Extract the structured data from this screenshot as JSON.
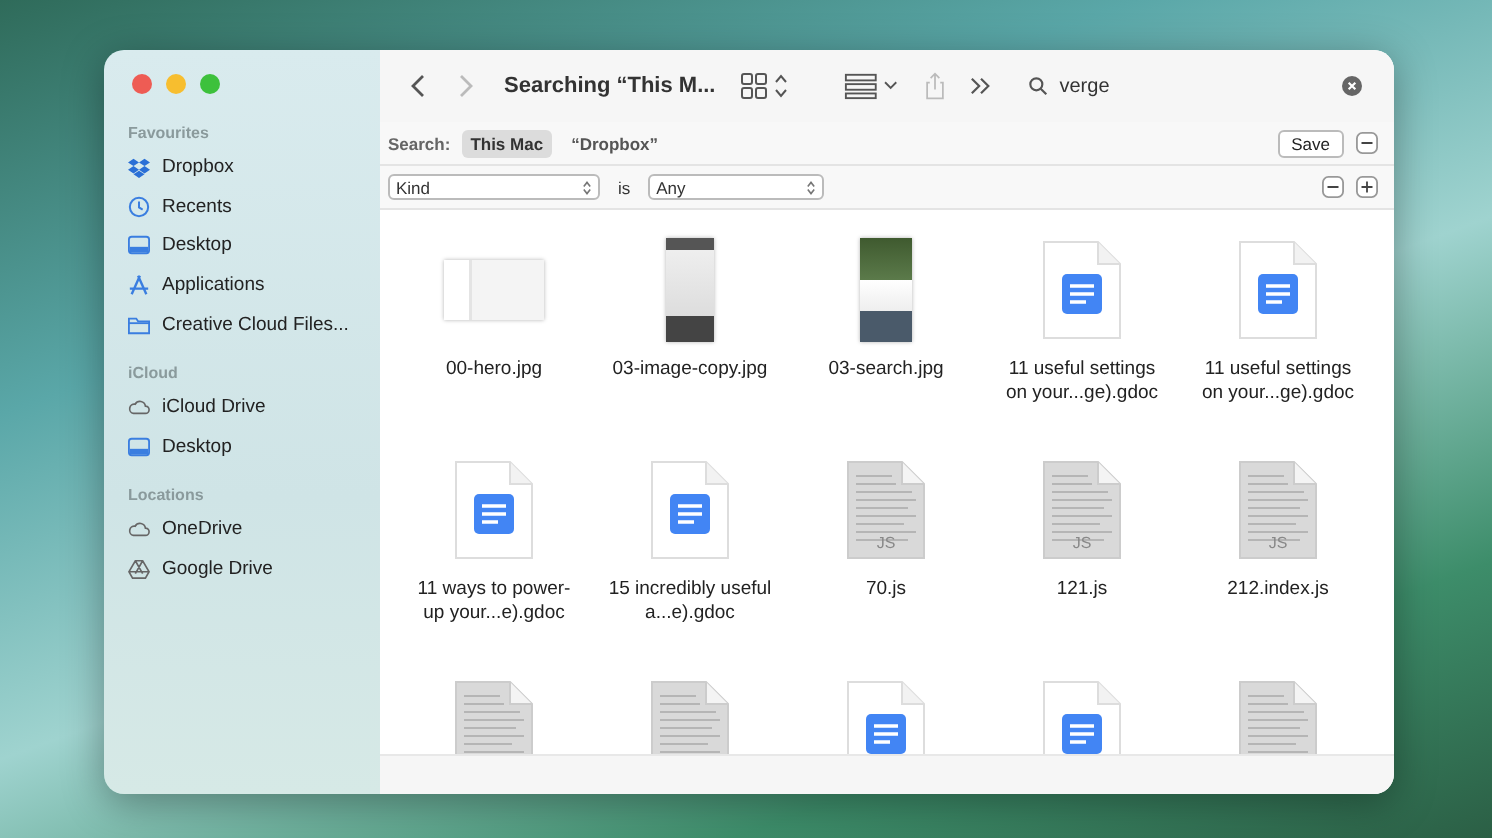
{
  "window": {
    "title": "Searching “This M..."
  },
  "sidebar": {
    "sections": [
      {
        "heading": "Favourites",
        "items": [
          {
            "label": "Dropbox",
            "kind": "dropbox"
          },
          {
            "label": "Recents",
            "kind": "clock"
          },
          {
            "label": "Desktop",
            "kind": "desktop"
          },
          {
            "label": "Applications",
            "kind": "apps"
          },
          {
            "label": "Creative Cloud Files...",
            "kind": "folder"
          }
        ]
      },
      {
        "heading": "iCloud",
        "items": [
          {
            "label": "iCloud Drive",
            "kind": "cloud"
          },
          {
            "label": "Desktop",
            "kind": "desktop"
          }
        ]
      },
      {
        "heading": "Locations",
        "items": [
          {
            "label": "OneDrive",
            "kind": "cloud"
          },
          {
            "label": "Google Drive",
            "kind": "drive"
          }
        ]
      }
    ]
  },
  "search": {
    "value": "verge"
  },
  "scope": {
    "label": "Search:",
    "options": [
      {
        "label": "This Mac",
        "selected": true
      },
      {
        "label": "“Dropbox”",
        "selected": false
      }
    ],
    "save": "Save"
  },
  "criteria": {
    "attribute": "Kind",
    "operator": "is",
    "value": "Any"
  },
  "files": [
    {
      "name": "00-hero.jpg",
      "kind": "screenshot"
    },
    {
      "name": "03-image-copy.jpg",
      "kind": "phone"
    },
    {
      "name": "03-search.jpg",
      "kind": "photo"
    },
    {
      "name": "11 useful settings on your...ge).gdoc",
      "kind": "gdoc"
    },
    {
      "name": "11 useful settings on your...ge).gdoc",
      "kind": "gdoc"
    },
    {
      "name": "11 ways to power-up your...e).gdoc",
      "kind": "gdoc"
    },
    {
      "name": "15 incredibly useful a...e).gdoc",
      "kind": "gdoc"
    },
    {
      "name": "70.js",
      "kind": "js",
      "badge": "JS"
    },
    {
      "name": "121.js",
      "kind": "js",
      "badge": "JS"
    },
    {
      "name": "212.index.js",
      "kind": "js",
      "badge": "JS"
    },
    {
      "kind": "js"
    },
    {
      "kind": "js"
    },
    {
      "kind": "gdoc"
    },
    {
      "kind": "gdoc"
    },
    {
      "kind": "js"
    }
  ]
}
